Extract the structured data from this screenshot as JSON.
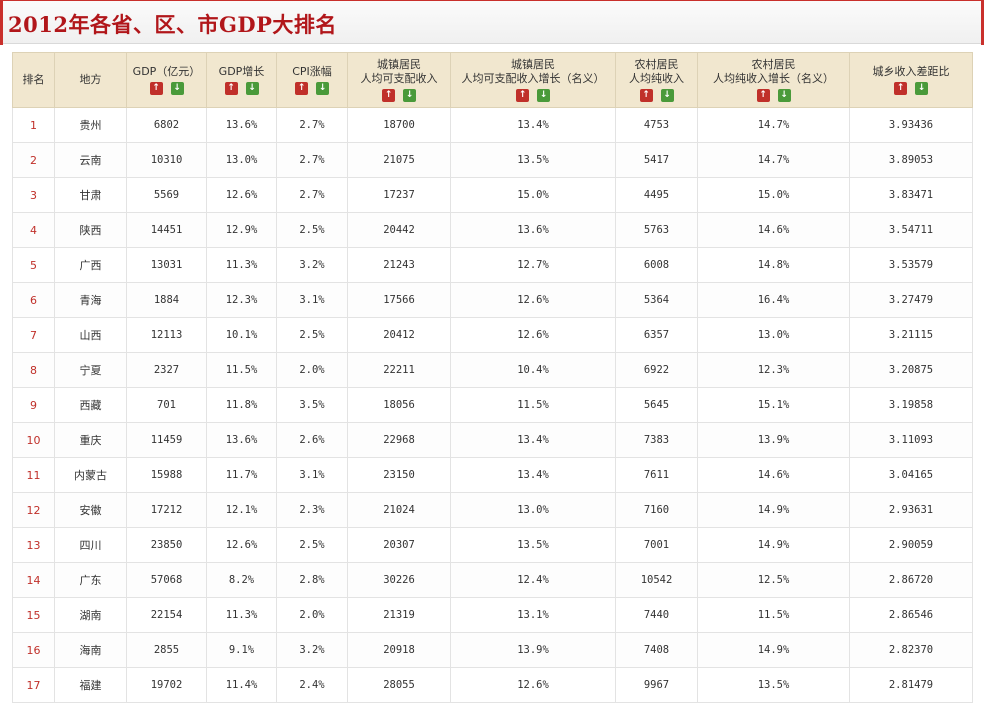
{
  "page": {
    "title": "2012年各省、区、市GDP大排名"
  },
  "icons": {
    "sort_up": "arrow-up-icon",
    "sort_down": "arrow-down-icon"
  },
  "colors": {
    "title": "#b1161a",
    "header_bg": "#f1e7cf",
    "sort_up": "#c0302a",
    "sort_down": "#4a9a3a"
  },
  "table": {
    "headers": [
      {
        "line1": "排名",
        "line2": "",
        "sortable": false
      },
      {
        "line1": "地方",
        "line2": "",
        "sortable": false
      },
      {
        "line1": "GDP（亿元）",
        "line2": "",
        "sortable": true
      },
      {
        "line1": "GDP增长",
        "line2": "",
        "sortable": true
      },
      {
        "line1": "CPI涨幅",
        "line2": "",
        "sortable": true
      },
      {
        "line1": "城镇居民",
        "line2": "人均可支配收入",
        "sortable": true
      },
      {
        "line1": "城镇居民",
        "line2": "人均可支配收入增长（名义）",
        "sortable": true
      },
      {
        "line1": "农村居民",
        "line2": "人均纯收入",
        "sortable": true
      },
      {
        "line1": "农村居民",
        "line2": "人均纯收入增长（名义）",
        "sortable": true
      },
      {
        "line1": "城乡收入差距比",
        "line2": "",
        "sortable": true
      }
    ],
    "rows": [
      [
        "1",
        "贵州",
        "6802",
        "13.6%",
        "2.7%",
        "18700",
        "13.4%",
        "4753",
        "14.7%",
        "3.93436"
      ],
      [
        "2",
        "云南",
        "10310",
        "13.0%",
        "2.7%",
        "21075",
        "13.5%",
        "5417",
        "14.7%",
        "3.89053"
      ],
      [
        "3",
        "甘肃",
        "5569",
        "12.6%",
        "2.7%",
        "17237",
        "15.0%",
        "4495",
        "15.0%",
        "3.83471"
      ],
      [
        "4",
        "陕西",
        "14451",
        "12.9%",
        "2.5%",
        "20442",
        "13.6%",
        "5763",
        "14.6%",
        "3.54711"
      ],
      [
        "5",
        "广西",
        "13031",
        "11.3%",
        "3.2%",
        "21243",
        "12.7%",
        "6008",
        "14.8%",
        "3.53579"
      ],
      [
        "6",
        "青海",
        "1884",
        "12.3%",
        "3.1%",
        "17566",
        "12.6%",
        "5364",
        "16.4%",
        "3.27479"
      ],
      [
        "7",
        "山西",
        "12113",
        "10.1%",
        "2.5%",
        "20412",
        "12.6%",
        "6357",
        "13.0%",
        "3.21115"
      ],
      [
        "8",
        "宁夏",
        "2327",
        "11.5%",
        "2.0%",
        "22211",
        "10.4%",
        "6922",
        "12.3%",
        "3.20875"
      ],
      [
        "9",
        "西藏",
        "701",
        "11.8%",
        "3.5%",
        "18056",
        "11.5%",
        "5645",
        "15.1%",
        "3.19858"
      ],
      [
        "10",
        "重庆",
        "11459",
        "13.6%",
        "2.6%",
        "22968",
        "13.4%",
        "7383",
        "13.9%",
        "3.11093"
      ],
      [
        "11",
        "内蒙古",
        "15988",
        "11.7%",
        "3.1%",
        "23150",
        "13.4%",
        "7611",
        "14.6%",
        "3.04165"
      ],
      [
        "12",
        "安徽",
        "17212",
        "12.1%",
        "2.3%",
        "21024",
        "13.0%",
        "7160",
        "14.9%",
        "2.93631"
      ],
      [
        "13",
        "四川",
        "23850",
        "12.6%",
        "2.5%",
        "20307",
        "13.5%",
        "7001",
        "14.9%",
        "2.90059"
      ],
      [
        "14",
        "广东",
        "57068",
        "8.2%",
        "2.8%",
        "30226",
        "12.4%",
        "10542",
        "12.5%",
        "2.86720"
      ],
      [
        "15",
        "湖南",
        "22154",
        "11.3%",
        "2.0%",
        "21319",
        "13.1%",
        "7440",
        "11.5%",
        "2.86546"
      ],
      [
        "16",
        "海南",
        "2855",
        "9.1%",
        "3.2%",
        "20918",
        "13.9%",
        "7408",
        "14.9%",
        "2.82370"
      ],
      [
        "17",
        "福建",
        "19702",
        "11.4%",
        "2.4%",
        "28055",
        "12.6%",
        "9967",
        "13.5%",
        "2.81479"
      ]
    ]
  }
}
